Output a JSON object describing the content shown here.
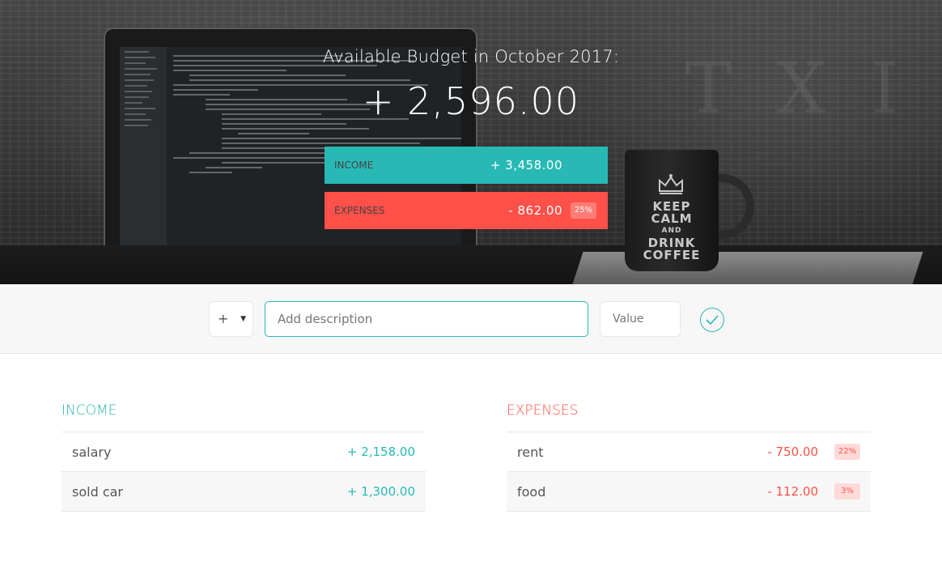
{
  "header": {
    "title": "Available Budget in October 2017:",
    "budget": "+ 2,596.00",
    "income": {
      "label": "Income",
      "value": "+ 3,458.00"
    },
    "expenses": {
      "label": "Expenses",
      "value": "- 862.00",
      "percentage": "25%"
    }
  },
  "add_form": {
    "type_value": "+",
    "description_placeholder": "Add description",
    "value_placeholder": "Value"
  },
  "income": {
    "title": "Income",
    "items": [
      {
        "description": "salary",
        "value": "+ 2,158.00"
      },
      {
        "description": "sold car",
        "value": "+ 1,300.00"
      }
    ]
  },
  "expenses": {
    "title": "Expenses",
    "items": [
      {
        "description": "rent",
        "value": "- 750.00",
        "percentage": "22%"
      },
      {
        "description": "food",
        "value": "- 112.00",
        "percentage": "3%"
      }
    ]
  },
  "mug": {
    "line1": "KEEP",
    "line2": "CALM",
    "line3": "AND",
    "line4": "DRINK",
    "line5": "COFFEE"
  },
  "colors": {
    "income": "#28B9B5",
    "expenses": "#FF5049"
  },
  "icons": {
    "add_button": "checkmark-circle-icon",
    "type_caret": "chevron-down-icon"
  }
}
